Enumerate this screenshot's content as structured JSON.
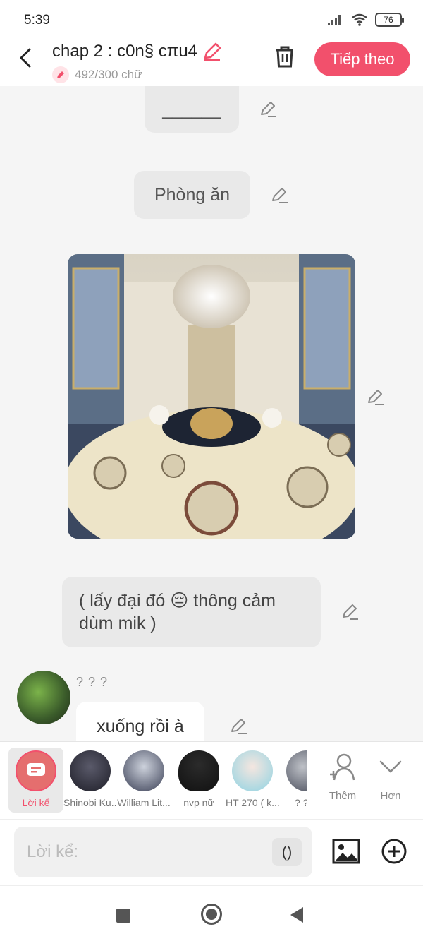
{
  "status_bar": {
    "time": "5:39",
    "battery": "76"
  },
  "header": {
    "title": "chap 2 : c0n§ cπu4",
    "word_count": "492/300 chữ",
    "next_label": "Tiếp theo"
  },
  "messages": {
    "divider": "______",
    "scene_label": "Phòng ăn",
    "narration": "( lấy đại đó 😔 thông cảm dùm mik )",
    "character_name": "? ? ?",
    "character_text": "xuống rồi à"
  },
  "picker": {
    "items": [
      {
        "label": "Lời kể"
      },
      {
        "label": "Shinobi Ku..."
      },
      {
        "label": "William Lit..."
      },
      {
        "label": "nvp nữ"
      },
      {
        "label": "HT 270 ( k..."
      },
      {
        "label": "? ?"
      }
    ],
    "add_label": "Thêm",
    "more_label": "Hơn"
  },
  "input": {
    "placeholder": "Lời kể:",
    "paren_label": "()"
  },
  "colors": {
    "accent": "#f2506c",
    "bubble": "#e9e9e9",
    "background": "#f5f5f5"
  }
}
